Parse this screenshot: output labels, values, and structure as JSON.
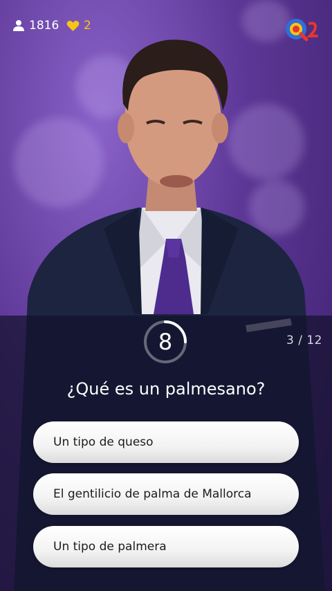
{
  "stats": {
    "viewers": "1816",
    "lives": "2"
  },
  "app": {
    "logo_icon": "q12-logo-icon"
  },
  "quiz": {
    "timer": "8",
    "timer_fraction": 0.25,
    "progress": "3 / 12",
    "question": "¿Qué es un palmesano?",
    "answers": [
      "Un tipo de queso",
      "El gentilicio de palma de Mallorca",
      "Un tipo de palmera"
    ]
  },
  "colors": {
    "accent_purple": "#5d3796",
    "heart": "#f5c518",
    "logo_red": "#e8362c",
    "logo_blue": "#2f6fd6"
  }
}
